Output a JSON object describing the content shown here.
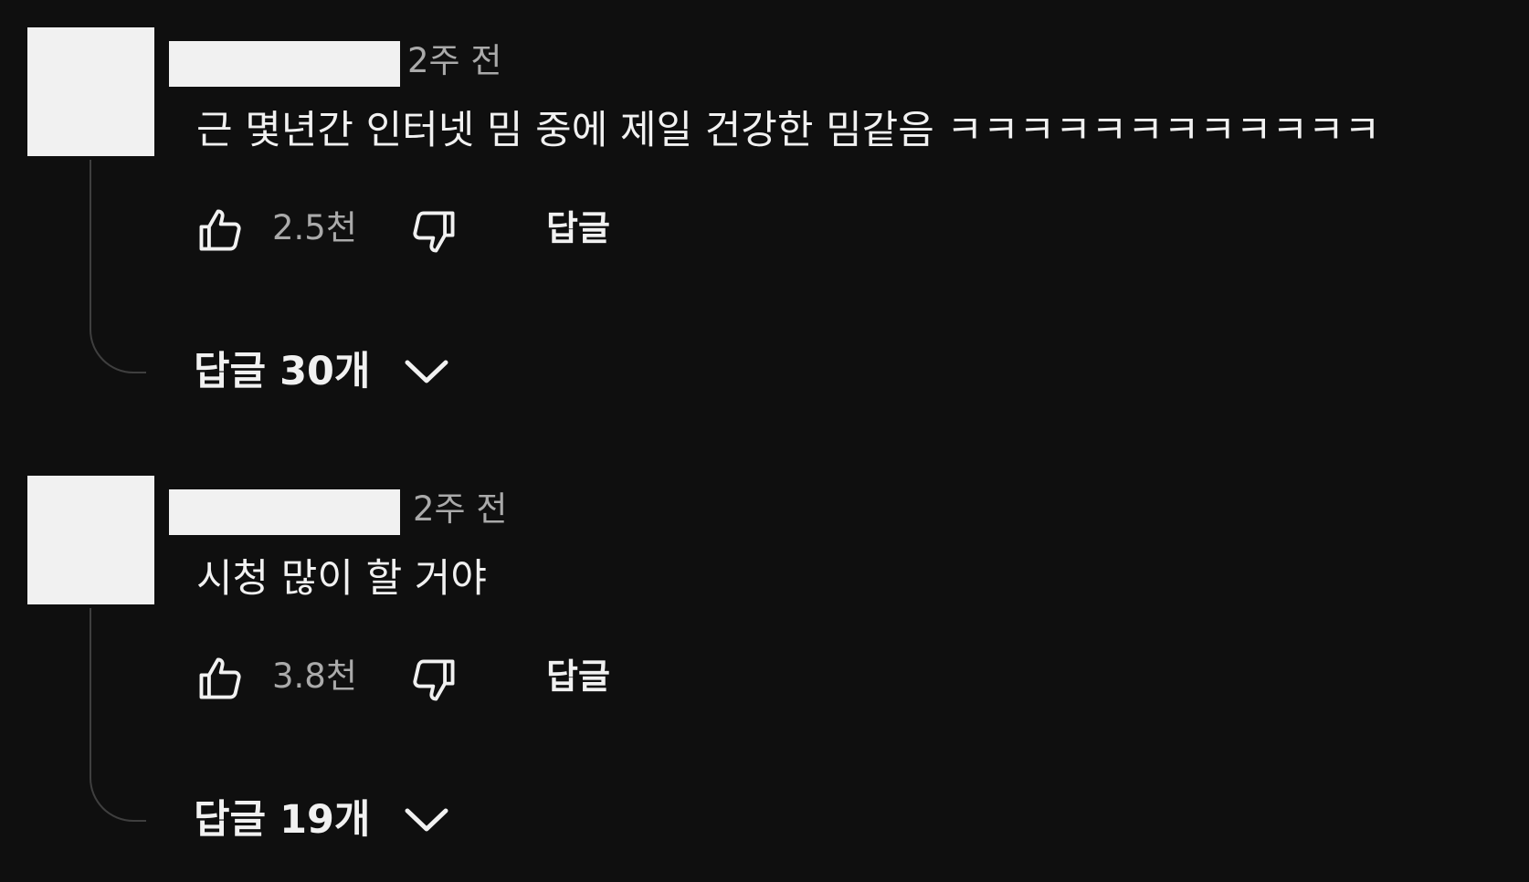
{
  "comments": [
    {
      "timestamp": "2주 전",
      "text": "근 몇년간 인터넷 밈 중에 제일 건강한 밈같음 ㅋㅋㅋㅋㅋㅋㅋㅋㅋㅋㅋㅋ",
      "like_count": "2.5천",
      "reply_label": "답글",
      "replies_label": "답글 30개"
    },
    {
      "timestamp": "2주 전",
      "text": "시청 많이 할 거야",
      "like_count": "3.8천",
      "reply_label": "답글",
      "replies_label": "답글 19개"
    }
  ],
  "icons": {
    "like": "thumbs-up-icon",
    "dislike": "thumbs-down-icon",
    "expand": "chevron-down-icon"
  },
  "colors": {
    "background": "#0f0f0f",
    "text_primary": "#f1f1f1",
    "text_secondary": "#aaaaaa",
    "thread_line": "#3f3f3f"
  }
}
